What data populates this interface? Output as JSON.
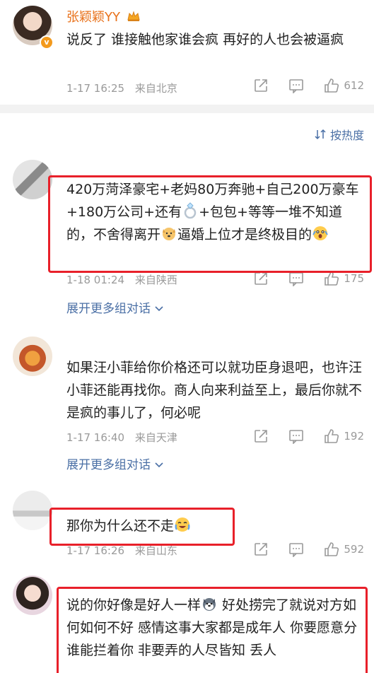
{
  "comments": [
    {
      "username": "张颖颖YY",
      "text": "说反了 谁接触他家谁会疯 再好的人也会被逼疯",
      "date": "1-17 16:25",
      "location": "来自北京",
      "likes": "612"
    },
    {
      "text_parts": [
        "420万菏泽豪宅+老妈80万奔驰+自己200万豪车+180万公司+还有",
        "+包包+等等一堆不知道的，不舍得离开",
        "逼婚上位才是终极目的"
      ],
      "date": "1-18 01:24",
      "location": "来自陕西",
      "likes": "175",
      "expand": "展开更多组对话"
    },
    {
      "text": "如果汪小菲给你价格还可以就功臣身退吧，也许汪小菲还能再找你。商人向来利益至上，最后你就不是疯的事儿了，何必呢",
      "date": "1-17 16:40",
      "location": "来自天津",
      "likes": "192",
      "expand": "展开更多组对话"
    },
    {
      "text": "那你为什么还不走",
      "date": "1-17 16:26",
      "location": "来自山东",
      "likes": "592"
    },
    {
      "text_parts": [
        "说的你好像是好人一样",
        " 好处捞完了就说对方如何如何不好 感情这事大家都是成年人 你要愿意分谁能拦着你 非要弄的人尽皆知 丢人"
      ]
    }
  ],
  "sort_label": "按热度",
  "icons": {
    "share": "share-icon",
    "comment": "comment-icon",
    "like": "thumbs-up-icon",
    "sort": "sort-icon",
    "crown": "crown-icon",
    "verify": "verified-badge-icon",
    "ring": "ring-emoji-icon",
    "dog": "dog-emoji-icon",
    "scream": "scream-emoji-icon",
    "crying": "crying-laugh-emoji-icon",
    "husky": "husky-emoji-icon"
  },
  "colors": {
    "username": "#e8721c",
    "link": "#4a6fa5",
    "meta": "#9a9a9a",
    "highlight_box": "#e8202a"
  }
}
